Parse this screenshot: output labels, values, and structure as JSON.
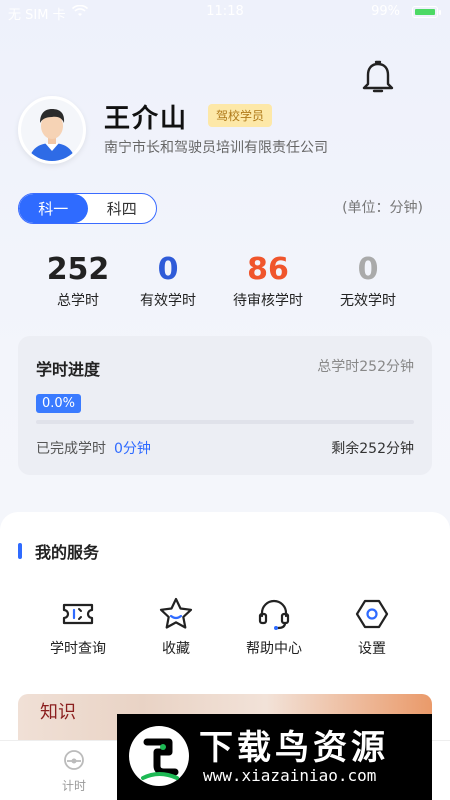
{
  "status_bar": {
    "carrier": "无 SIM 卡",
    "time": "11:18",
    "battery": "99%"
  },
  "profile": {
    "name": "王介山",
    "badge": "驾校学员",
    "company": "南宁市长和驾驶员培训有限责任公司"
  },
  "subject_tabs": [
    {
      "label": "科一",
      "active": true
    },
    {
      "label": "科四",
      "active": false
    }
  ],
  "unit_label": "(单位：分钟)",
  "stats": [
    {
      "value": "252",
      "label": "总学时",
      "color": "#222222"
    },
    {
      "value": "0",
      "label": "有效学时",
      "color": "#2f5bd8"
    },
    {
      "value": "86",
      "label": "待审核学时",
      "color": "#f0552c"
    },
    {
      "value": "0",
      "label": "无效学时",
      "color": "#aaaaaa"
    }
  ],
  "progress": {
    "title": "学时进度",
    "total_text": "总学时252分钟",
    "percent_text": "0.0%",
    "percent_value": 0.0,
    "completed_label": "已完成学时",
    "completed_value": "0分钟",
    "remaining_text": "剩余252分钟"
  },
  "services": {
    "title": "我的服务",
    "items": [
      {
        "label": "学时查询",
        "icon": "ticket-icon"
      },
      {
        "label": "收藏",
        "icon": "star-icon"
      },
      {
        "label": "帮助中心",
        "icon": "headset-icon"
      },
      {
        "label": "设置",
        "icon": "settings-hex-icon"
      }
    ]
  },
  "banner": {
    "seal_text": "知识"
  },
  "tabbar": {
    "items": [
      {
        "label": "计时",
        "icon": "timer-icon"
      }
    ]
  },
  "watermark": {
    "title": "下载鸟资源",
    "url": "www.xiazainiao.com"
  },
  "colors": {
    "accent": "#2f6bff",
    "badge_bg": "#fde8a8",
    "badge_text": "#b07a1a"
  }
}
